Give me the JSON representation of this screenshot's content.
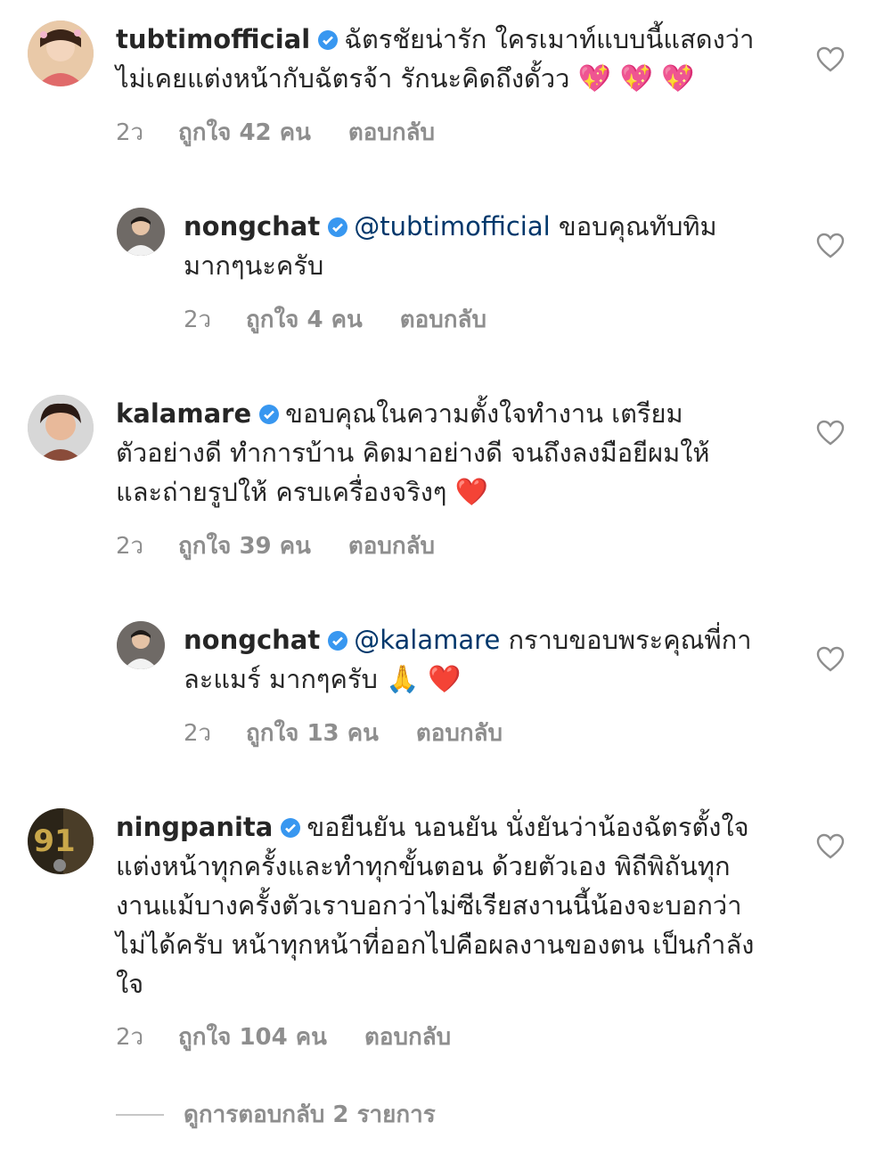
{
  "comments": [
    {
      "username": "tubtimofficial",
      "mention": "",
      "text": "ฉัตรชัยน่ารัก ใครเมาท์แบบนี้แสดงว่าไม่เคยแต่งหน้ากับฉัตรจ้า รักนะคิดถึงดั้วว",
      "emoji": "💖 💖 💖",
      "time": "2ว",
      "likes": "ถูกใจ 42 คน",
      "reply": "ตอบกลับ"
    },
    {
      "username": "nongchat",
      "mention": "@tubtimofficial",
      "text": "ขอบคุณทับทิมมากๆนะครับ",
      "emoji": "",
      "time": "2ว",
      "likes": "ถูกใจ 4 คน",
      "reply": "ตอบกลับ"
    },
    {
      "username": "kalamare",
      "mention": "",
      "text": "ขอบคุณในความตั้งใจทำงาน เตรียมตัวอย่างดี ทำการบ้าน คิดมาอย่างดี จนถึงลงมือยีผมให้ และถ่ายรูปให้ ครบเครื่องจริงๆ",
      "emoji": "❤️",
      "time": "2ว",
      "likes": "ถูกใจ 39 คน",
      "reply": "ตอบกลับ"
    },
    {
      "username": "nongchat",
      "mention": "@kalamare",
      "text": "กราบขอบพระคุณพี่กาละแมร์ มากๆครับ",
      "emoji": "🙏 ❤️",
      "time": "2ว",
      "likes": "ถูกใจ 13 คน",
      "reply": "ตอบกลับ"
    },
    {
      "username": "ningpanita",
      "mention": "",
      "text": "ขอยืนยัน นอนยัน นั่งยันว่าน้องฉัตรตั้งใจแต่งหน้าทุกครั้งและทำทุกขั้นตอน ด้วยตัวเอง พิถีพิถันทุกงานแม้บางครั้งตัวเราบอกว่าไม่ซีเรียสงานนี้น้องจะบอกว่า ไม่ได้ครับ หน้าทุกหน้าที่ออกไปคือผลงานของตน เป็นกำลังใจ",
      "emoji": "",
      "time": "2ว",
      "likes": "ถูกใจ 104 คน",
      "reply": "ตอบกลับ"
    }
  ],
  "view_replies": "ดูการตอบกลับ 2 รายการ",
  "avatar_badge": "91",
  "colors": {
    "verified": "#3897f0",
    "mention": "#00376b",
    "meta": "#8e8e8e"
  }
}
